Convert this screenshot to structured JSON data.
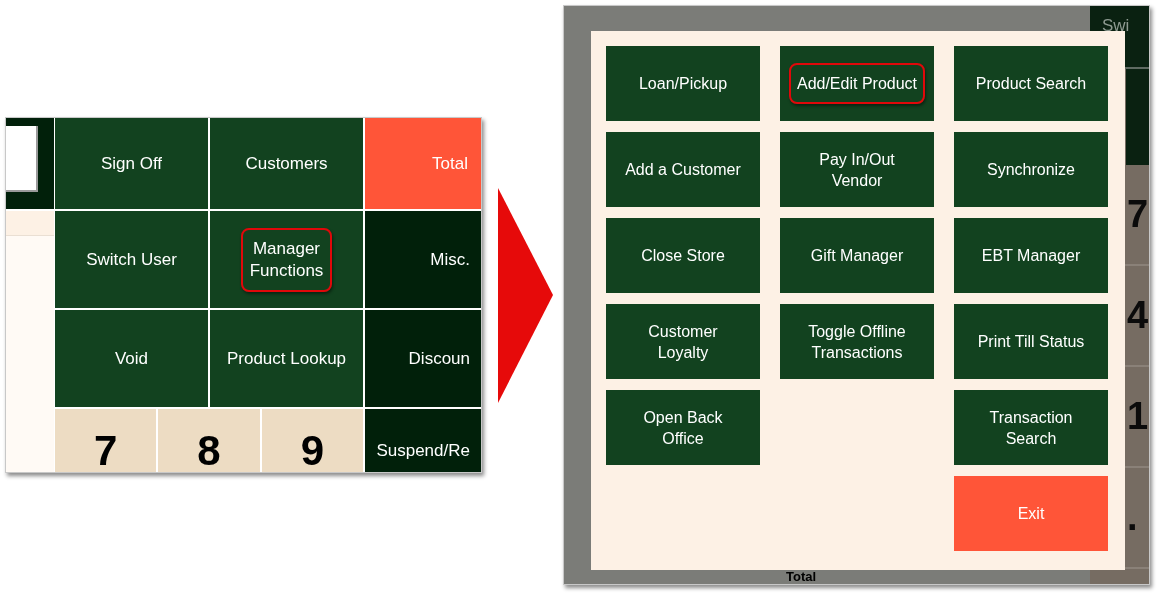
{
  "left_screenshot": {
    "rows": [
      {
        "cells": [
          {
            "label": "Sign Off",
            "kind": "action",
            "highlighted": false
          },
          {
            "label": "Customers",
            "kind": "action",
            "highlighted": false
          },
          {
            "label": "Total",
            "kind": "total",
            "highlighted": false
          }
        ]
      },
      {
        "cells": [
          {
            "label": "Switch User",
            "kind": "action",
            "highlighted": false
          },
          {
            "label": "Manager\nFunctions",
            "kind": "action",
            "highlighted": true
          },
          {
            "label": "Misc.",
            "kind": "function",
            "highlighted": false
          }
        ]
      },
      {
        "cells": [
          {
            "label": "Void",
            "kind": "action",
            "highlighted": false
          },
          {
            "label": "Product Lookup",
            "kind": "action",
            "highlighted": false
          },
          {
            "label": "Discoun",
            "kind": "function",
            "highlighted": false
          }
        ]
      }
    ],
    "bottom_row": {
      "keys": [
        "7",
        "8",
        "9"
      ],
      "button": {
        "label": "Suspend/Re",
        "kind": "function",
        "highlighted": false
      }
    }
  },
  "right_screenshot": {
    "background": {
      "side_button": "Swi",
      "keypad": [
        "7",
        "4",
        "1",
        "."
      ],
      "total_label": "Total"
    },
    "dialog": {
      "columns": [
        [
          {
            "label": "Loan/Pickup",
            "kind": "action",
            "highlighted": false
          },
          {
            "label": "Add a Customer",
            "kind": "action",
            "highlighted": false
          },
          {
            "label": "Close Store",
            "kind": "action",
            "highlighted": false
          },
          {
            "label": "Customer\nLoyalty",
            "kind": "action",
            "highlighted": false
          },
          {
            "label": "Open Back\nOffice",
            "kind": "action",
            "highlighted": false
          }
        ],
        [
          {
            "label": "Add/Edit Product",
            "kind": "action",
            "highlighted": true
          },
          {
            "label": "Pay In/Out\nVendor",
            "kind": "action",
            "highlighted": false
          },
          {
            "label": "Gift Manager",
            "kind": "action",
            "highlighted": false
          },
          {
            "label": "Toggle Offline\nTransactions",
            "kind": "action",
            "highlighted": false
          }
        ],
        [
          {
            "label": "Product Search",
            "kind": "action",
            "highlighted": false
          },
          {
            "label": "Synchronize",
            "kind": "action",
            "highlighted": false
          },
          {
            "label": "EBT Manager",
            "kind": "action",
            "highlighted": false
          },
          {
            "label": "Print Till Status",
            "kind": "action",
            "highlighted": false
          },
          {
            "label": "Transaction\nSearch",
            "kind": "action",
            "highlighted": false
          },
          {
            "label": "Exit",
            "kind": "exit",
            "highlighted": false
          }
        ]
      ]
    }
  }
}
